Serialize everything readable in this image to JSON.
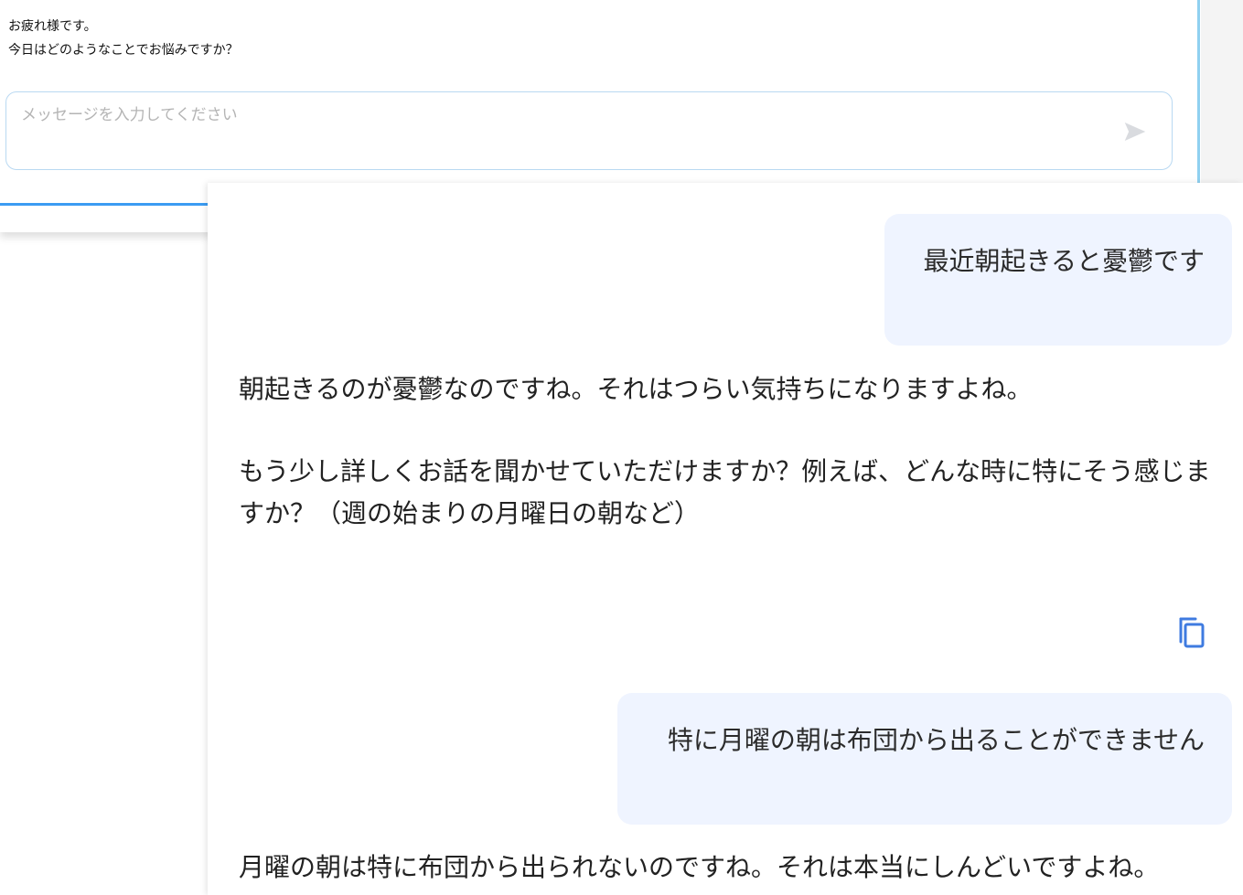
{
  "background_window": {
    "greeting": {
      "line1": "お疲れ様です。",
      "line2": "今日はどのようなことでお悩みですか？"
    },
    "input": {
      "placeholder": "メッセージを入力してください",
      "value": ""
    },
    "send_icon": "send-icon"
  },
  "chat": {
    "user_messages": [
      {
        "text": "最近朝起きると憂鬱です"
      },
      {
        "text": "特に月曜の朝は布団から出ることができません"
      }
    ],
    "assistant_messages": [
      {
        "paragraphs": [
          "朝起きるのが憂鬱なのですね。それはつらい気持ちになりますよね。",
          "もう少し詳しくお話を聞かせていただけますか？例えば、どんな時に特にそう感じますか？（週の始まりの月曜日の朝など）"
        ]
      },
      {
        "paragraphs": [
          "月曜の朝は特に布団から出られないのですね。それは本当にしんどいですよね。"
        ]
      }
    ],
    "copy_icon": "copy-icon"
  },
  "colors": {
    "accent": "#3b9cf2",
    "copy_icon": "#3f7be0",
    "user_bubble_bg": "#eff4ff",
    "input_border": "#b9d9f2"
  }
}
